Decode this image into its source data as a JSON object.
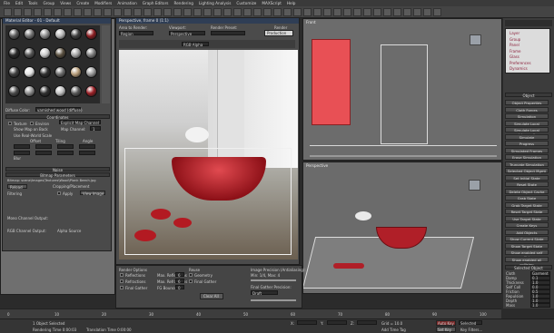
{
  "menu": [
    "File",
    "Edit",
    "Tools",
    "Group",
    "Views",
    "Create",
    "Modifiers",
    "Animation",
    "Graph Editors",
    "Rendering",
    "Lighting Analysis",
    "Customize",
    "MAXScript",
    "Help"
  ],
  "viewports": {
    "top_left_label": "Left",
    "top_right_label": "Front",
    "bottom_right_label": "Perspective"
  },
  "material_editor": {
    "title": "Material Editor - 01 - Default",
    "material_name": "varnished wood (diffuse)",
    "rollout_coordinates": "Coordinates",
    "rollout_noise": "Noise",
    "rollout_bitmap": "Bitmap Parameters",
    "bitmap_path": "Bitmap: scene\\Images\\Textures\\Wood\\Plank Beech.jpg",
    "reload_label": "Reload",
    "filtering_label": "Filtering",
    "cropping_label": "Cropping/Placement",
    "mono_channel_label": "Mono Channel Output:",
    "rgb_channel_label": "RGB Channel Output:",
    "alpha_source_label": "Alpha Source",
    "apply_label": "Apply",
    "view_image_label": "View Image",
    "tiling_label": "Tiling",
    "offset_label": "Offset",
    "angle_label": "Angle",
    "blur_label": "Blur",
    "diffuse_label": "Diffuse Color:",
    "show_map_label": "Show Map on Back",
    "use_real_world_label": "Use Real-World Scale",
    "texture_label": "Texture",
    "environ_label": "Environ",
    "mapping_label": "Explicit Map Channel",
    "map_channel_label": "Map Channel:",
    "map_channel_value": "1"
  },
  "render_frame": {
    "title": "Perspective, frame 0 (1:1)",
    "area_label": "Area to Render:",
    "area_value": "Region",
    "viewport_label": "Viewport:",
    "viewport_value": "Perspective",
    "preset_label": "Render Preset:",
    "preset_value": "",
    "render_button": "Render",
    "production_value": "Production",
    "channel_value": "RGB Alpha"
  },
  "render_settings": {
    "options_label": "Render Options",
    "reflections": "Reflections",
    "refractions": "Refractions",
    "fg": "Final Gather",
    "image_precision_label": "Image Precision (Antialiasing):",
    "image_precision_value": "Min: 1/4, Max: 4",
    "fg_precision_label": "Final Gather Precision:",
    "fg_precision_value": "Draft",
    "glossy_label": "Glossy Reflections Precision:",
    "trace_label": "Trace/Bounces Limits",
    "max_reflections": "Max. Reflections",
    "max_refractions": "Max. Refractions",
    "fg_bounces": "FG Bounces",
    "reflect_val": "6",
    "refract_val": "6",
    "bounce_val": "0",
    "reuse_label": "Reuse",
    "geometry_label": "Geometry",
    "final_gather_label": "Final Gather",
    "clear_button": "Clear All",
    "output_label": "Output Result",
    "shadows_label": "Shadows",
    "auto_label": "Auto"
  },
  "command_panel": {
    "layer_items": [
      "Layer",
      "Group",
      "Panel",
      "Frame",
      "Glass",
      "Preferences",
      "Dynamics"
    ],
    "object_rollout": "Object",
    "buttons": [
      "Object Properties",
      "Cloth Forces",
      "Simulation",
      "Simulate Local",
      "Simulate Local (damped)",
      "Simulate",
      "Progress",
      "Simulated Frames",
      "Erase Simulation",
      "Truncate Simulation",
      "Selected Object Mgmt",
      "Set Initial State",
      "Reset State",
      "Delete Object Cache",
      "Grab State",
      "Grab Target State",
      "Reset Target State",
      "Use Target State",
      "Create Keys",
      "Add Objects",
      "Show Current State",
      "Show Target State",
      "Show enabled self collision",
      "Show enabled all collision"
    ],
    "bottom_rollout": "Selected Object",
    "props": [
      {
        "label": "Cloth",
        "value": "Garment"
      },
      {
        "label": "Damp",
        "value": "0.1"
      },
      {
        "label": "Thickness",
        "value": "1.0"
      },
      {
        "label": "Self Coll",
        "value": "0.0"
      },
      {
        "label": "Friction",
        "value": "0.5"
      },
      {
        "label": "Repulsion",
        "value": "1.0"
      },
      {
        "label": "Depth",
        "value": "1.0"
      },
      {
        "label": "Mass",
        "value": "1.0"
      }
    ]
  },
  "status": {
    "selection": "1 Object Selected",
    "render_time": "Rendering Time 0:00:03",
    "translation": "Translation Time 0:00:00",
    "x_label": "X:",
    "y_label": "Y:",
    "z_label": "Z:",
    "grid_label": "Grid = 10.0",
    "auto_key": "Auto Key",
    "set_key": "Set Key",
    "selected_label": "Selected",
    "add_time_tag": "Add Time Tag",
    "key_filters": "Key Filters..."
  },
  "timeline_frames": [
    "0",
    "10",
    "20",
    "30",
    "40",
    "50",
    "60",
    "70",
    "80",
    "90",
    "100"
  ],
  "colors": {
    "accent_blue": "#2f3e55",
    "basin_red": "#b01f28",
    "viewport_grey": "#6f6f6f",
    "curtain_red": "#e85055"
  }
}
